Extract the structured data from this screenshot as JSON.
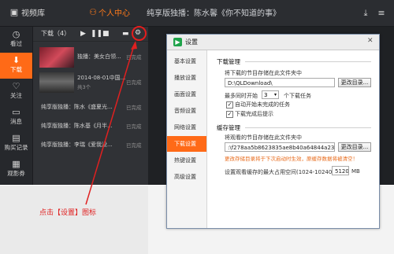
{
  "topbar": {
    "tab_library": "视频库",
    "tab_personal": "个人中心",
    "now_playing": "纯享版独播：陈水馨《你不知道的事》"
  },
  "leftnav": {
    "items": [
      {
        "label": "看过",
        "icon": "clock-icon"
      },
      {
        "label": "下载",
        "icon": "download-icon"
      },
      {
        "label": "关注",
        "icon": "heart-icon"
      },
      {
        "label": "消息",
        "icon": "message-icon"
      },
      {
        "label": "购买记录",
        "icon": "receipt-icon"
      },
      {
        "label": "观影券",
        "icon": "ticket-icon"
      }
    ]
  },
  "downloads": {
    "header": "下载（4）",
    "items": [
      {
        "title": "独播：美女白领...",
        "status": "已完成",
        "has_thumb": true
      },
      {
        "title": "2014-08-01中国...",
        "sub": "共3个",
        "status": "已完成",
        "has_thumb": true
      },
      {
        "title": "纯享版独播：陈水《盛夏光...",
        "status": "已完成",
        "has_thumb": false
      },
      {
        "title": "纯享版独播：陈水基《月半...",
        "status": "已完成",
        "has_thumb": false
      },
      {
        "title": "纯享版独播：李瑞《爱我没...",
        "status": "已完成",
        "has_thumb": false
      }
    ]
  },
  "annotation": "点击【设置】图标",
  "dialog": {
    "title": "设置",
    "sidebar": [
      "基本设置",
      "播放设置",
      "画面设置",
      "音频设置",
      "网络设置",
      "下载设置",
      "热键设置",
      "高级设置"
    ],
    "active_index": 5,
    "download_mgmt": {
      "heading": "下载管理",
      "path_label": "将下载的节目存储在此文件夹中",
      "path_value": "D:\\QLDownload\\",
      "change_button": "更改目录...",
      "max_prefix": "最多同时开始",
      "max_value": "3",
      "max_suffix": "个下载任务",
      "auto_resume": "自动开始未完成的任务",
      "done_notify": "下载完成后提示"
    },
    "cache_mgmt": {
      "heading": "缓存管理",
      "path_label": "将观看的节目存储在此文件夹中",
      "path_value": ":\\f278aa5b8623835ae8b40a64844a239c\\",
      "change_button": "更改目录...",
      "note": "更改存储目录将于下次启动时生效，原缓存数据将被清空！",
      "limit_label": "设置观看缓存的最大占用空间(1024-10240)",
      "limit_value": "5120",
      "limit_unit": "MB"
    }
  },
  "colors": {
    "accent": "#ff6a17",
    "annotation": "#e02020"
  }
}
